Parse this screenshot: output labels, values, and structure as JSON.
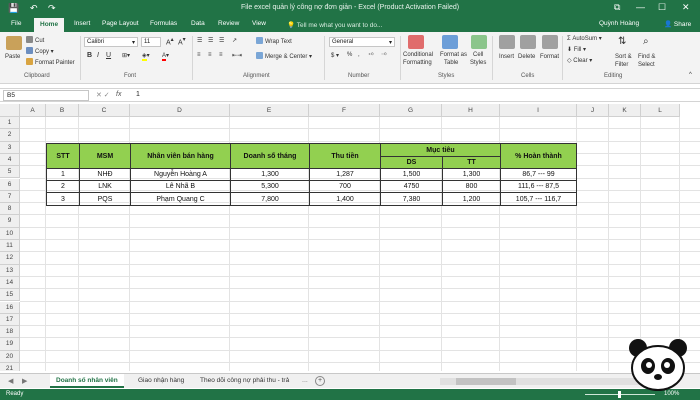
{
  "titlebar": {
    "title": "File excel quản lý công nợ đơn giản - Excel (Product Activation Failed)",
    "qa_save": "💾",
    "qa_undo": "↶",
    "qa_redo": "↷",
    "win_restore": "⧉",
    "win_min": "—",
    "win_max": "☐",
    "win_close": "✕"
  },
  "tabs": [
    "File",
    "Home",
    "Insert",
    "Page Layout",
    "Formulas",
    "Data",
    "Review",
    "View"
  ],
  "tell_me": "Tell me what you want to do...",
  "user": "Quỳnh Hoàng",
  "share": "Share",
  "ribbon": {
    "clipboard": {
      "paste": "Paste",
      "cut": "Cut",
      "copy": "Copy",
      "format_painter": "Format Painter",
      "label": "Clipboard"
    },
    "font": {
      "name": "Calibri",
      "size": "11",
      "label": "Font",
      "bold": "B",
      "italic": "I",
      "underline": "U"
    },
    "alignment": {
      "wrap": "Wrap Text",
      "merge": "Merge & Center",
      "label": "Alignment"
    },
    "number": {
      "format": "General",
      "label": "Number",
      "currency": "$",
      "percent": "%"
    },
    "styles": {
      "conditional_1": "Conditional",
      "conditional_2": "Formatting",
      "format_as_1": "Format as",
      "format_as_2": "Table",
      "cell_1": "Cell",
      "cell_2": "Styles",
      "label": "Styles"
    },
    "cells": {
      "insert": "Insert",
      "delete": "Delete",
      "format": "Format",
      "label": "Cells"
    },
    "editing": {
      "autosum": "AutoSum",
      "fill": "Fill",
      "clear": "Clear",
      "sort_1": "Sort &",
      "sort_2": "Filter",
      "find_1": "Find &",
      "find_2": "Select",
      "label": "Editing"
    }
  },
  "formula_bar": {
    "name_box": "B5",
    "fx": "fx",
    "value": "1"
  },
  "columns": [
    "A",
    "B",
    "C",
    "D",
    "E",
    "F",
    "G",
    "H",
    "I",
    "J",
    "K",
    "L"
  ],
  "rows": [
    "1",
    "2",
    "3",
    "4",
    "5",
    "6",
    "7",
    "8",
    "9",
    "10",
    "11",
    "12",
    "13",
    "14",
    "15",
    "16",
    "17",
    "18",
    "19",
    "20",
    "21"
  ],
  "table": {
    "headers": {
      "stt": "STT",
      "msm": "MSM",
      "nv": "Nhân viên bán hàng",
      "doanh_so": "Doanh số tháng",
      "thu_tien": "Thu tiền",
      "muc_tieu": "Mục tiêu",
      "ds": "DS",
      "tt": "TT",
      "hoan_thanh": "% Hoàn thành"
    },
    "rows": [
      {
        "stt": "1",
        "msm": "NHĐ",
        "nv": "Nguyễn Hoàng A",
        "doanh_so": "1,300",
        "thu_tien": "1,287",
        "ds": "1,500",
        "tt": "1,300",
        "ht": "86,7 --- 99"
      },
      {
        "stt": "2",
        "msm": "LNK",
        "nv": "Lê Nhã B",
        "doanh_so": "5,300",
        "thu_tien": "700",
        "ds": "4750",
        "tt": "800",
        "ht": "111,6 --- 87,5"
      },
      {
        "stt": "3",
        "msm": "PQS",
        "nv": "Phạm Quang C",
        "doanh_so": "7,800",
        "thu_tien": "1,400",
        "ds": "7,380",
        "tt": "1,200",
        "ht": "105,7 --- 116,7"
      }
    ]
  },
  "sheets": [
    "Doanh số nhân viên",
    "Giao nhận hàng",
    "Theo dõi công nợ phải thu - trả"
  ],
  "sheet_nav": {
    "prev": "◀",
    "next": "▶",
    "ellipsis": "...",
    "add": "+"
  },
  "statusbar": {
    "ready": "Ready",
    "zoom": "100%"
  },
  "colors": {
    "excel_green": "#217346",
    "header_fill": "#92d050"
  }
}
